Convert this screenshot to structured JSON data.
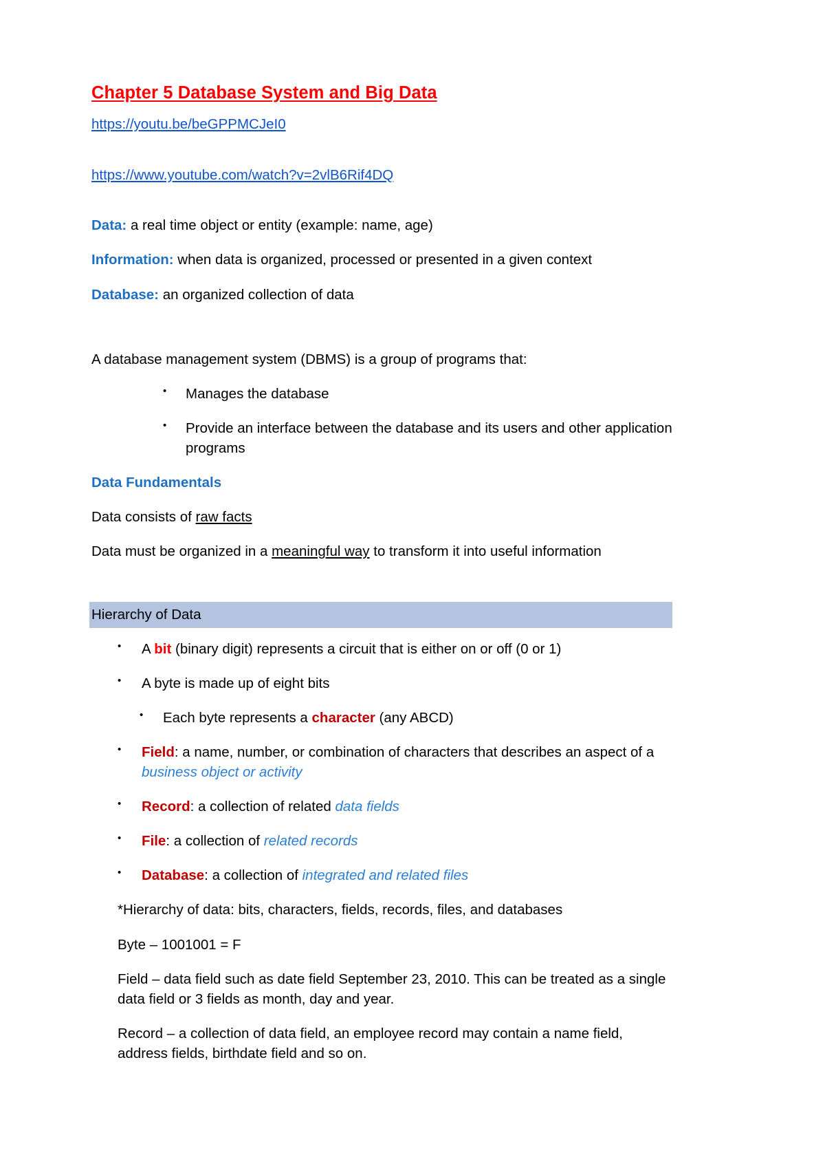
{
  "document": {
    "title": "Chapter 5 Database System and Big Data",
    "links": [
      {
        "text": "https://youtu.be/beGPPMCJeI0"
      },
      {
        "text": "https://www.youtube.com/watch?v=2vlB6Rif4DQ"
      }
    ],
    "definitions": [
      {
        "label": "Data:",
        "text": " a real time object or entity (example: name, age)"
      },
      {
        "label": "Information:",
        "text": " when data is organized, processed or presented in a given context"
      },
      {
        "label": "Database:",
        "text": " an organized collection of data"
      }
    ],
    "dbms": {
      "intro": "A database management system (DBMS) is a group of programs that:",
      "bullets": [
        "Manages the database",
        "Provide an interface between the database and its users and other application programs"
      ]
    },
    "data_fundamentals": {
      "heading": "Data Fundamentals",
      "line1_pre": "Data consists of ",
      "line1_underlined": "raw facts",
      "line2_pre": "Data must be organized in a ",
      "line2_underlined": "meaningful way",
      "line2_post": " to transform it into useful information"
    },
    "hierarchy": {
      "band_title": "Hierarchy of Data",
      "bullet_bit": {
        "pre": "A ",
        "term": "bit",
        "post": " (binary digit) represents a circuit that is either on or off (0 or 1)"
      },
      "bullet_byte": "A byte is made up of eight bits",
      "bullet_character": {
        "pre": "Each byte represents a ",
        "term": "character",
        "post": " (any ABCD)"
      },
      "bullet_field": {
        "term": "Field",
        "mid": ": a name, number, or combination of characters that describes an aspect of a ",
        "italic": "business object or activity"
      },
      "bullet_record": {
        "term": "Record",
        "mid": ": a collection of related ",
        "italic": "data fields"
      },
      "bullet_file": {
        "term": "File",
        "mid": ": a collection of ",
        "italic": "related records"
      },
      "bullet_database": {
        "term": "Database",
        "mid": ": a collection of ",
        "italic": "integrated and related files"
      },
      "note_hierarchy": "*Hierarchy of data: bits, characters, fields, records, files, and databases",
      "note_byte": "Byte – 1001001 = F",
      "note_field": "Field – data field such as date field September 23, 2010. This can be treated as a single data field or 3 fields as month, day and year.",
      "note_record": "Record – a collection of data field, an employee record may contain a name field, address fields, birthdate field and so on."
    }
  },
  "colors": {
    "title_red": "#ff0000",
    "link_blue": "#1155cc",
    "label_blue": "#1f6fc4",
    "term_red": "#c00000",
    "bright_red": "#ff0000",
    "italic_blue": "#2a7fd4",
    "highlight_band": "#b4c3e0"
  }
}
